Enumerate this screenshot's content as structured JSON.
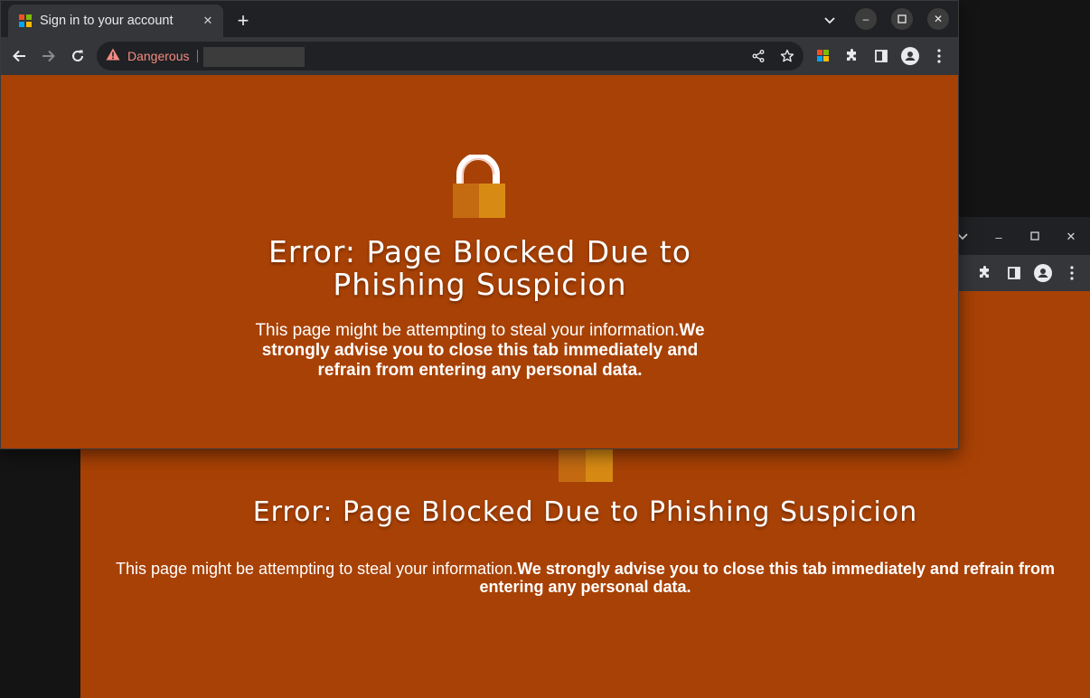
{
  "front_window": {
    "tab": {
      "title": "Sign in to your account",
      "close_glyph": "✕"
    },
    "new_tab_glyph": "+",
    "window_controls": {
      "dropdown": "⌄",
      "minimize": "–",
      "maximize": "☐",
      "close": "✕"
    },
    "omnibox": {
      "security_label": "Dangerous",
      "url": ""
    },
    "page": {
      "icon": "lock-icon",
      "heading": "Error: Page Blocked Due to Phishing Suspicion",
      "body_normal": "This page might be attempting to steal your information.",
      "body_bold": "We strongly advise you to close this tab immediately and refrain from entering any personal data."
    }
  },
  "back_window": {
    "window_controls": {
      "dropdown": "⌄",
      "minimize": "–",
      "maximize": "☐",
      "close": "✕"
    },
    "page": {
      "icon": "lock-icon",
      "heading": "Error: Page Blocked Due to Phishing Suspicion",
      "body_normal": "This page might be attempting to steal your information.",
      "body_bold": "We strongly advise you to close this tab immediately and refrain from entering any personal data."
    }
  },
  "colors": {
    "page_background": "#a84105",
    "lock_body_left": "#c46b12",
    "lock_body_right": "#d88b14",
    "danger_text": "#f28b82",
    "browser_chrome": "#202124",
    "toolbar": "#35363a"
  }
}
